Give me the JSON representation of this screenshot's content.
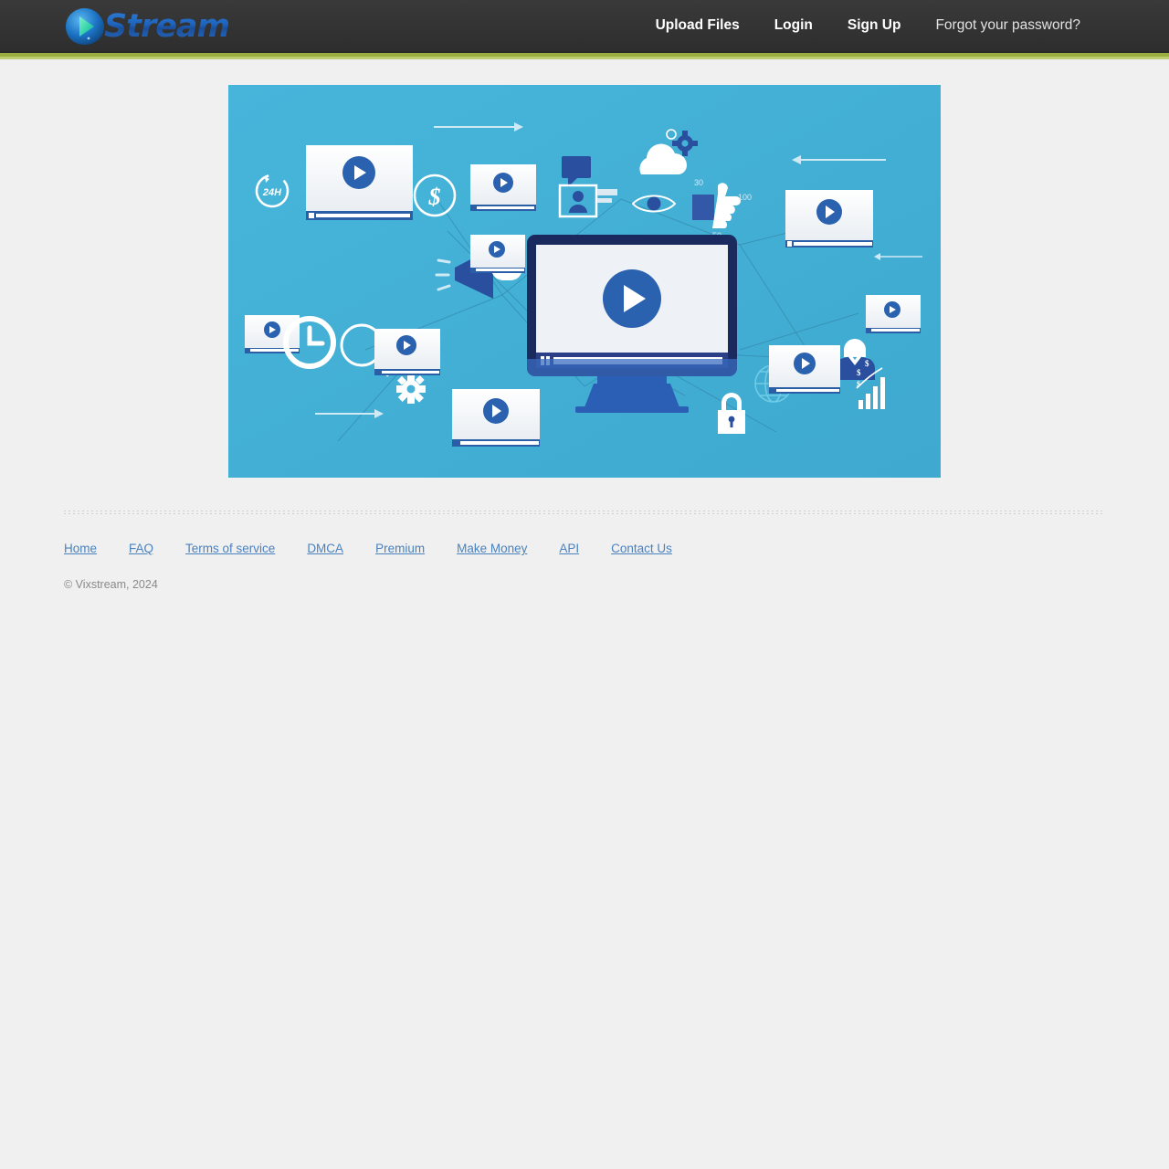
{
  "site": {
    "logo_text": "Stream",
    "logo_icon": "play-triangle-icon"
  },
  "header": {
    "nav": [
      {
        "label": "Upload Files",
        "name": "nav-upload-files",
        "style": "bold"
      },
      {
        "label": "Login",
        "name": "nav-login",
        "style": "bold"
      },
      {
        "label": "Sign Up",
        "name": "nav-signup",
        "style": "bold"
      },
      {
        "label": "Forgot your password?",
        "name": "nav-forgot-password",
        "style": "muted"
      }
    ],
    "background_color": "#343434",
    "accent_rule_color": "#9aad3f"
  },
  "hero": {
    "alt": "video streaming network illustration",
    "background_color": "#45b3d8",
    "icon_labels": {
      "badge_24h": "24H",
      "likes_count": "100",
      "views_count": "30",
      "shares_count": "50",
      "money_symbol": "$"
    },
    "icons": [
      "video-card-icon",
      "play-button-icon",
      "clock-icon",
      "gear-icon",
      "magnifier-icon",
      "megaphone-icon",
      "cloud-icon",
      "eye-icon",
      "thumbs-up-icon",
      "speech-bubble-icon",
      "user-card-icon",
      "globe-icon",
      "lock-icon",
      "bar-chart-icon",
      "dollar-circle-icon",
      "monitor-icon",
      "arrow-right-icon",
      "arrow-left-icon"
    ]
  },
  "footer": {
    "links": [
      {
        "label": "Home",
        "name": "footer-link-home"
      },
      {
        "label": "FAQ",
        "name": "footer-link-faq"
      },
      {
        "label": "Terms of service",
        "name": "footer-link-terms"
      },
      {
        "label": "DMCA",
        "name": "footer-link-dmca"
      },
      {
        "label": "Premium",
        "name": "footer-link-premium"
      },
      {
        "label": "Make Money",
        "name": "footer-link-make-money"
      },
      {
        "label": "API",
        "name": "footer-link-api"
      },
      {
        "label": "Contact Us",
        "name": "footer-link-contact"
      }
    ],
    "copyright": "© Vixstream, 2024",
    "link_color": "#4a82bd"
  }
}
